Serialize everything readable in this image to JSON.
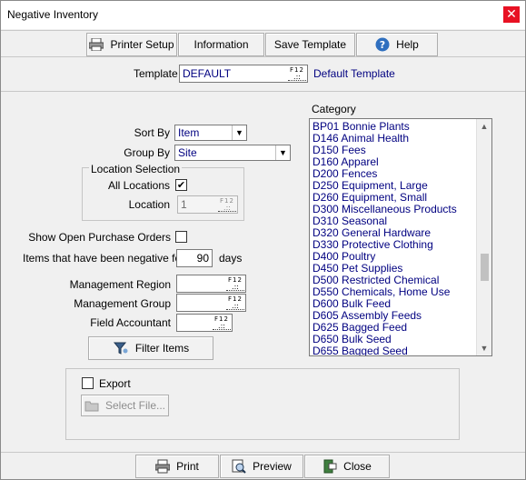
{
  "window": {
    "title": "Negative Inventory",
    "close_glyph": "✕"
  },
  "toolbar": {
    "printer_setup": "Printer Setup",
    "information": "Information",
    "save_template": "Save Template",
    "help": "Help"
  },
  "template": {
    "label": "Template",
    "value": "DEFAULT",
    "description": "Default Template",
    "lookup_key": "F12"
  },
  "filters": {
    "sort_by_label": "Sort By",
    "sort_by_value": "Item",
    "group_by_label": "Group By",
    "group_by_value": "Site",
    "location_selection_label": "Location Selection",
    "all_locations_label": "All Locations",
    "all_locations_checked": true,
    "location_label": "Location",
    "location_value": "1",
    "show_open_po_label": "Show Open Purchase Orders",
    "show_open_po_checked": false,
    "negative_for_label": "Items that have been negative for",
    "negative_for_value": "90",
    "negative_for_unit": "days",
    "management_region_label": "Management Region",
    "management_group_label": "Management Group",
    "field_accountant_label": "Field Accountant",
    "filter_items_button": "Filter Items"
  },
  "category": {
    "label": "Category",
    "items": [
      "BP01 Bonnie Plants",
      "D146 Animal Health",
      "D150 Fees",
      "D160 Apparel",
      "D200 Fences",
      "D250 Equipment, Large",
      "D260 Equipment, Small",
      "D300 Miscellaneous Products",
      "D310 Seasonal",
      "D320 General Hardware",
      "D330 Protective Clothing",
      "D400 Poultry",
      "D450 Pet Supplies",
      "D500 Restricted Chemical",
      "D550 Chemicals, Home Use",
      "D600 Bulk Feed",
      "D605 Assembly Feeds",
      "D625 Bagged Feed",
      "D650 Bulk Seed",
      "D655 Bagged Seed"
    ]
  },
  "export": {
    "label": "Export",
    "checked": false,
    "select_file": "Select File..."
  },
  "footer": {
    "print": "Print",
    "preview": "Preview",
    "close": "Close"
  },
  "icons": {
    "printer_setup": "printer-icon",
    "help": "help-icon",
    "filter": "filter-icon",
    "print": "print-icon",
    "preview": "preview-icon",
    "close": "exit-icon",
    "select_file": "folder-icon"
  }
}
